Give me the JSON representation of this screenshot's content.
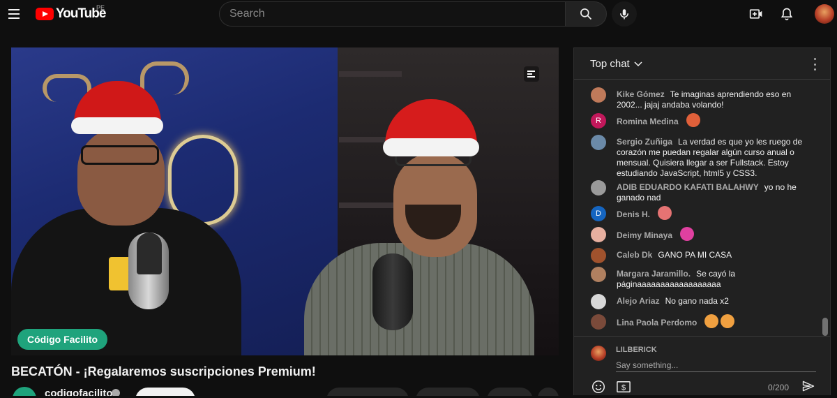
{
  "header": {
    "logo_text": "YouTube",
    "country_code": "PE",
    "search_placeholder": "Search"
  },
  "video": {
    "channel_badge": "Código Facilito",
    "title": "BECATÓN - ¡Regalaremos suscripciones Premium!"
  },
  "channel": {
    "name": "codigofacilito"
  },
  "chat": {
    "mode_label": "Top chat",
    "messages": [
      {
        "author": "Kike Gómez",
        "text": "Te imaginas aprendiendo eso en 2002... jajaj andaba volando!",
        "avatar_letter": "",
        "avatar_color": "#c07a5a"
      },
      {
        "author": "Romina Medina",
        "text": "",
        "avatar_letter": "R",
        "avatar_color": "#c2185b",
        "emojis": [
          "#e0603a"
        ]
      },
      {
        "author": "Sergio Zuñiga",
        "text": "La verdad es que yo les ruego de corazón me puedan regalar algún curso anual o mensual. Quisiera llegar a ser Fullstack. Estoy estudiando JavaScript, html5 y CSS3.",
        "avatar_letter": "",
        "avatar_color": "#6b8aa8"
      },
      {
        "author": "ADIB EDUARDO KAFATI BALAHWY",
        "text": "yo no he ganado nad",
        "avatar_letter": "",
        "avatar_color": "#9a9a9a"
      },
      {
        "author": "Denis H.",
        "text": "",
        "avatar_letter": "D",
        "avatar_color": "#1565c0",
        "emojis": [
          "#e57373"
        ]
      },
      {
        "author": "Deimy Minaya",
        "text": "",
        "avatar_letter": "",
        "avatar_color": "#e8b0a0",
        "emojis": [
          "#e040a0"
        ]
      },
      {
        "author": "Caleb Dk",
        "text": "GANO PA MI CASA",
        "avatar_letter": "",
        "avatar_color": "#a0522d"
      },
      {
        "author": "Margara Jaramillo.",
        "text": "Se cayó la páginaaaaaaaaaaaaaaaaaa",
        "avatar_letter": "",
        "avatar_color": "#b08060"
      },
      {
        "author": "Alejo Ariaz",
        "text": "No gano nada x2",
        "avatar_letter": "",
        "avatar_color": "#d8d8d8"
      },
      {
        "author": "Lina Paola Perdomo",
        "text": "",
        "avatar_letter": "",
        "avatar_color": "#7a4a3a",
        "emojis": [
          "#f0a040",
          "#f0a040"
        ]
      }
    ],
    "me_name": "LILBERICK",
    "input_placeholder": "Say something...",
    "char_counter": "0/200"
  }
}
